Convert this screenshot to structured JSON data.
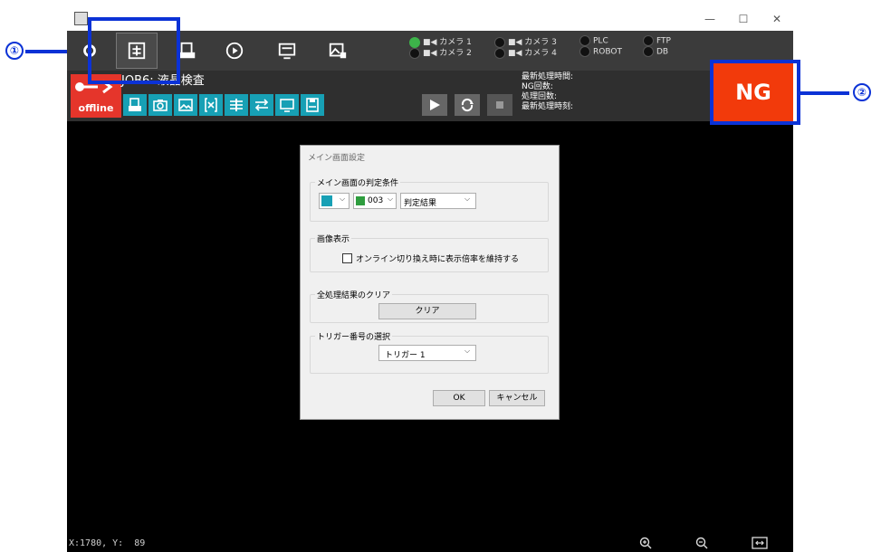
{
  "window": {
    "title": "",
    "minimize": "—",
    "maximize": "☐",
    "close": "✕"
  },
  "camera_status": [
    {
      "label": "カメラ 1",
      "active": true,
      "prefix": "A"
    },
    {
      "label": "カメラ 2",
      "active": false
    },
    {
      "label": "カメラ 3",
      "active": false
    },
    {
      "label": "カメラ 4",
      "active": false
    }
  ],
  "device_status": {
    "plc": "PLC",
    "robot": "ROBOT",
    "ftp": "FTP",
    "db": "DB"
  },
  "job": {
    "title": "JOB6: 液晶検査",
    "offline": "offline"
  },
  "info_labels": {
    "last_time": "最新処理時間:",
    "ng_count": "NG回数:",
    "proc_count": "処理回数:",
    "last_at": "最新処理時刻:"
  },
  "result_badge": "NG",
  "coords": "X:1780, Y:  89",
  "dialog": {
    "title": "メイン画面設定",
    "g1": {
      "title": "メイン画面の判定条件",
      "num": "003",
      "result": "判定結果"
    },
    "g2": {
      "title": "画像表示",
      "checkbox": "オンライン切り換え時に表示倍率を維持する"
    },
    "g3": {
      "title": "全処理結果のクリア",
      "button": "クリア"
    },
    "g4": {
      "title": "トリガー番号の選択",
      "trigger": "トリガー 1"
    },
    "ok": "OK",
    "cancel": "キャンセル"
  },
  "annotations": {
    "a1": "①",
    "a2": "②"
  },
  "colors": {
    "accent_blue": "#0b32d6",
    "ng_red": "#f23a0b",
    "teal": "#17a0b5",
    "offline_red": "#e5352b"
  }
}
